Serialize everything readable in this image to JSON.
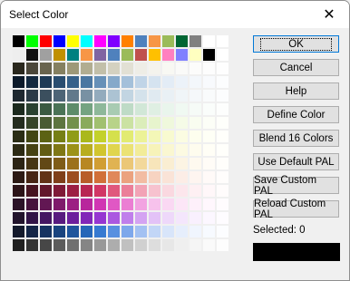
{
  "window": {
    "title": "Select Color",
    "close_glyph": "✕"
  },
  "buttons": {
    "ok": "OK",
    "cancel": "Cancel",
    "help": "Help",
    "define": "Define Color",
    "blend": "Blend 16 Colors",
    "use_default": "Use Default PAL",
    "save_custom": "Save Custom PAL",
    "reload_custom": "Reload Custom PAL"
  },
  "status": {
    "selected_label": "Selected: 0",
    "selected_color": "#000000"
  },
  "palette": [
    [
      "#000000",
      "#00ff00",
      "#ff0000",
      "#0000ff",
      "#ffff00",
      "#00ffff",
      "#ff00ff",
      "#8000ff",
      "#ff8000",
      "#4f81bd",
      "#f79646",
      "#9bbb59",
      "#006633",
      "#808080",
      "#ffffff",
      "#ffffff"
    ],
    [
      "#eeeeee",
      "#111111",
      "#a0a0a0",
      "#c09000",
      "#008080",
      "#f79646",
      "#8064a2",
      "#4f81bd",
      "#9bbb59",
      "#c0504d",
      "#ffc000",
      "#ff80c0",
      "#8080ff",
      "#ffffc0",
      "#000000",
      "#ffffff"
    ],
    [
      "#2a281e",
      "#4b473a",
      "#69644e",
      "#858061",
      "#9d9878",
      "#b1ad91",
      "#c2bfa9",
      "#d4d1c0",
      "#e2e0d4",
      "#eeede6",
      "#f4f3ed",
      "#f8f8f3",
      "#fafaf8",
      "#fcfcfb",
      "#fdfdfd",
      "#fefefe"
    ],
    [
      "#0c1a2a",
      "#13293f",
      "#1e3a56",
      "#294d70",
      "#356089",
      "#4a77a1",
      "#6690b8",
      "#85a9ca",
      "#a4c0da",
      "#c0d4e7",
      "#d5e3f0",
      "#e3ecf6",
      "#ecf2f9",
      "#f3f7fb",
      "#f8fafd",
      "#fcfdfe"
    ],
    [
      "#1e2830",
      "#2b3a46",
      "#3b4f5e",
      "#4d6476",
      "#61798b",
      "#7891a3",
      "#93abbd",
      "#acc3d3",
      "#c2d5e2",
      "#d4e2eb",
      "#e0eaf1",
      "#e9f0f5",
      "#f0f5f8",
      "#f5f8fa",
      "#f9fbfc",
      "#fcfdfe"
    ],
    [
      "#1c2a1e",
      "#2a4130",
      "#3a5a42",
      "#4a7356",
      "#5d8c6a",
      "#74a381",
      "#8eb89a",
      "#a8cbb2",
      "#bedbc6",
      "#d1e7d7",
      "#dfefe3",
      "#e9f5ec",
      "#f0f9f2",
      "#f6fbf7",
      "#fafdfb",
      "#fdfefd"
    ],
    [
      "#242c1e",
      "#364428",
      "#495c33",
      "#5d753f",
      "#73904c",
      "#8aaa5c",
      "#a1c070",
      "#b8d389",
      "#cbe2a2",
      "#dbedba",
      "#e7f4cd",
      "#eff8dc",
      "#f5fbe7",
      "#f9fdf0",
      "#fcfef7",
      "#fefffb"
    ],
    [
      "#2a2c14",
      "#424614",
      "#5c6214",
      "#767f15",
      "#909c17",
      "#aab81c",
      "#c3d12b",
      "#d5e04c",
      "#e2eb72",
      "#ecf297",
      "#f3f7b7",
      "#f8fad0",
      "#fbfce2",
      "#fdfeee",
      "#fefff6",
      "#fffffb"
    ],
    [
      "#2c2a14",
      "#464214",
      "#625c14",
      "#7f7715",
      "#9c9218",
      "#b8ad1f",
      "#d1c52f",
      "#e0d54e",
      "#ebe274",
      "#f2ec99",
      "#f7f3b9",
      "#faf7d1",
      "#fcfae2",
      "#fefcee",
      "#fffef6",
      "#fffffb"
    ],
    [
      "#2c2414",
      "#463514",
      "#624815",
      "#7f5c17",
      "#9c711b",
      "#b88722",
      "#d19e33",
      "#e0b352",
      "#ebc777",
      "#f2d89b",
      "#f7e5ba",
      "#faeed2",
      "#fcf4e3",
      "#fef9ef",
      "#fffcf7",
      "#fffefb"
    ],
    [
      "#2c1a14",
      "#462514",
      "#623216",
      "#7f3f1a",
      "#9c4d20",
      "#b85d29",
      "#d17039",
      "#e0885a",
      "#eba27f",
      "#f2bca3",
      "#f7d3c1",
      "#fae3d7",
      "#fcede6",
      "#fef5f0",
      "#fffaf8",
      "#fffdfc"
    ],
    [
      "#2c1418",
      "#461420",
      "#62172b",
      "#7f1a37",
      "#9c1f44",
      "#b82653",
      "#d13665",
      "#e0587d",
      "#eb7e99",
      "#f2a3b6",
      "#f7c2cf",
      "#fad8e0",
      "#fce6ec",
      "#fef0f3",
      "#fff7f9",
      "#fffcfc"
    ],
    [
      "#2c1428",
      "#46143c",
      "#621753",
      "#7f1a6b",
      "#9c1f83",
      "#b8269c",
      "#d136b3",
      "#e058c4",
      "#eb7ed3",
      "#f2a3e1",
      "#f7c2ec",
      "#fad8f3",
      "#fce6f7",
      "#fef0fa",
      "#fff7fd",
      "#fffcfe"
    ],
    [
      "#22142c",
      "#321446",
      "#451762",
      "#581a7f",
      "#6c1f9c",
      "#8126b8",
      "#9636d1",
      "#ab58e0",
      "#c07eeb",
      "#d4a3f2",
      "#e3c2f7",
      "#eed8fa",
      "#f4e6fc",
      "#f9f0fe",
      "#fcf7ff",
      "#fefcff"
    ],
    [
      "#141a2c",
      "#142546",
      "#173462",
      "#1a447f",
      "#1f559c",
      "#2667b8",
      "#367ad1",
      "#5890e0",
      "#7ea8eb",
      "#a3c1f2",
      "#c2d6f7",
      "#d8e5fa",
      "#e6eefc",
      "#f0f5fe",
      "#f7faff",
      "#fcfdff"
    ],
    [
      "#202020",
      "#333333",
      "#474747",
      "#5c5c5c",
      "#707070",
      "#858585",
      "#999999",
      "#adadad",
      "#c0c0c0",
      "#d0d0d0",
      "#dddddd",
      "#e7e7e7",
      "#efefef",
      "#f5f5f5",
      "#fafafa",
      "#fdfdfd"
    ]
  ]
}
